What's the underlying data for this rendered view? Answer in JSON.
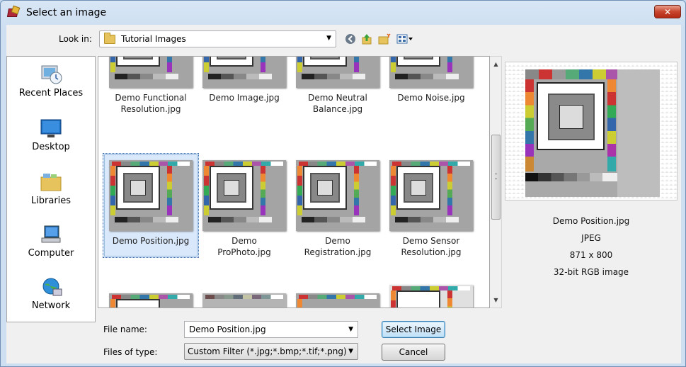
{
  "window": {
    "title": "Select an image",
    "close_label": "x"
  },
  "lookin": {
    "label": "Look in:",
    "folder": "Tutorial Images"
  },
  "toolbar_icons": [
    "back-icon",
    "up-folder-icon",
    "new-folder-icon",
    "view-menu-icon"
  ],
  "places": [
    {
      "label": "Recent Places",
      "icon": "recent-places-icon"
    },
    {
      "label": "Desktop",
      "icon": "desktop-icon"
    },
    {
      "label": "Libraries",
      "icon": "libraries-icon"
    },
    {
      "label": "Computer",
      "icon": "computer-icon"
    },
    {
      "label": "Network",
      "icon": "network-icon"
    }
  ],
  "files": [
    {
      "line1": "Demo Functional",
      "line2": "Resolution.jpg"
    },
    {
      "line1": "Demo Image.jpg",
      "line2": ""
    },
    {
      "line1": "Demo Neutral",
      "line2": "Balance.jpg"
    },
    {
      "line1": "Demo Noise.jpg",
      "line2": ""
    },
    {
      "line1": "Demo Position.jpg",
      "line2": ""
    },
    {
      "line1": "Demo",
      "line2": "ProPhoto.jpg"
    },
    {
      "line1": "Demo",
      "line2": "Registration.jpg"
    },
    {
      "line1": "Demo Sensor",
      "line2": "Resolution.jpg"
    }
  ],
  "selected_file": "Demo Position.jpg",
  "preview_info": {
    "name": "Demo Position.jpg",
    "format": "JPEG",
    "dimensions": "871 x 800",
    "color": "32-bit RGB image"
  },
  "bottom": {
    "filename_label": "File name:",
    "filename_value": "Demo Position.jpg",
    "filetype_label": "Files of type:",
    "filetype_value": "Custom Filter (*.jpg;*.bmp;*.tif;*.png)",
    "select_button": "Select Image",
    "cancel_button": "Cancel"
  }
}
